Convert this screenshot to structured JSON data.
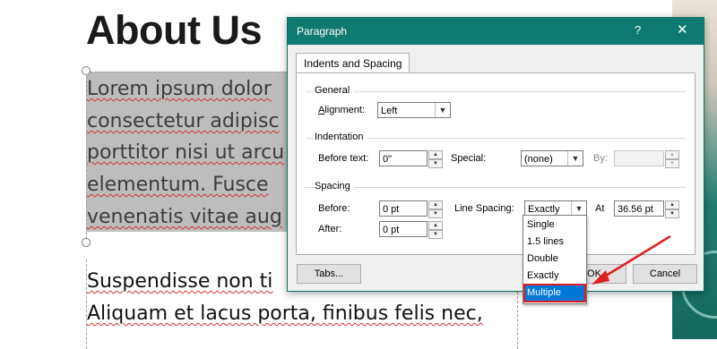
{
  "document": {
    "title": "About Us",
    "selected_lines": [
      "Lorem ipsum dolor",
      "consectetur adipisc",
      "porttitor nisi ut arcu",
      "elementum. Fusce",
      "venenatis vitae aug"
    ],
    "lines_after": [
      "Suspendisse non ti",
      "Aliquam et lacus porta, finibus felis nec,"
    ]
  },
  "dialog": {
    "title": "Paragraph",
    "help": "?",
    "close": "✕",
    "tab_label": "Indents and Spacing",
    "general": {
      "label": "General",
      "alignment_label": "Alignment:",
      "alignment_value": "Left"
    },
    "indentation": {
      "label": "Indentation",
      "before_text_label": "Before text:",
      "before_text_value": "0\"",
      "special_label": "Special:",
      "special_value": "(none)",
      "by_label": "By:",
      "by_value": ""
    },
    "spacing": {
      "label": "Spacing",
      "before_label": "Before:",
      "before_value": "0 pt",
      "after_label": "After:",
      "after_value": "0 pt",
      "line_spacing_label": "Line Spacing:",
      "line_spacing_value": "Exactly",
      "at_label": "At",
      "at_value": "36.56 pt"
    },
    "buttons": {
      "tabs": "Tabs...",
      "ok": "OK",
      "cancel": "Cancel"
    },
    "line_spacing_options": [
      "Single",
      "1.5 lines",
      "Double",
      "Exactly",
      "Multiple"
    ],
    "highlighted_option": "Multiple"
  },
  "colors": {
    "titlebar": "#0f7a72",
    "highlight": "#0078d7",
    "annotation": "#e02020"
  }
}
